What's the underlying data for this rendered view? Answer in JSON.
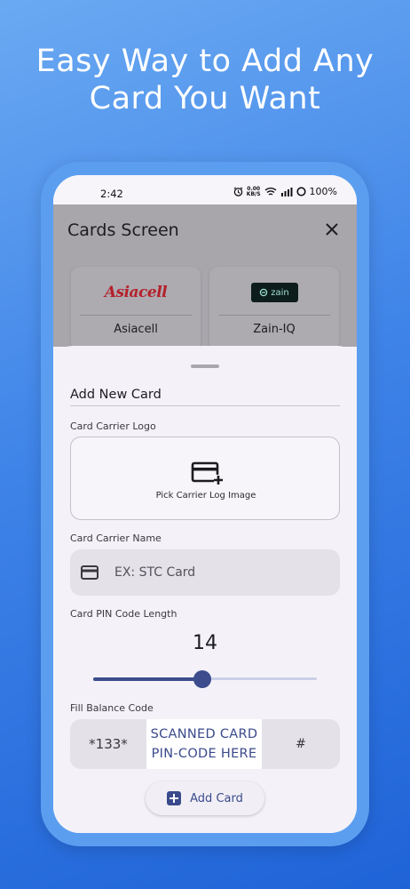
{
  "headline": {
    "line1": "Easy Way to Add Any",
    "line2": "Card You Want"
  },
  "status_bar": {
    "time": "2:42",
    "speed_value": "0.00",
    "speed_unit": "KB/S",
    "battery": "100%"
  },
  "app": {
    "title": "Cards Screen",
    "carriers": [
      {
        "name": "Asiacell",
        "logo_text": "Asiacell"
      },
      {
        "name": "Zain-IQ",
        "logo_text": "zain"
      }
    ]
  },
  "sheet": {
    "title": "Add New Card",
    "logo_label": "Card Carrier Logo",
    "logo_pick_text": "Pick Carrier Log Image",
    "name_label": "Card Carrier Name",
    "name_placeholder": "EX: STC Card",
    "pin_label": "Card PIN Code Length",
    "pin_value": "14",
    "pin_slider_fraction": 0.49,
    "balance_label": "Fill Balance Code",
    "balance_prefix": "*133*",
    "balance_mid_line1": "SCANNED CARD",
    "balance_mid_line2": "PIN-CODE HERE",
    "balance_suffix": "#",
    "add_button_label": "Add Card"
  },
  "colors": {
    "accent": "#3c4c8c",
    "background": "#3f84e8",
    "asiacell_red": "#b5202a"
  }
}
